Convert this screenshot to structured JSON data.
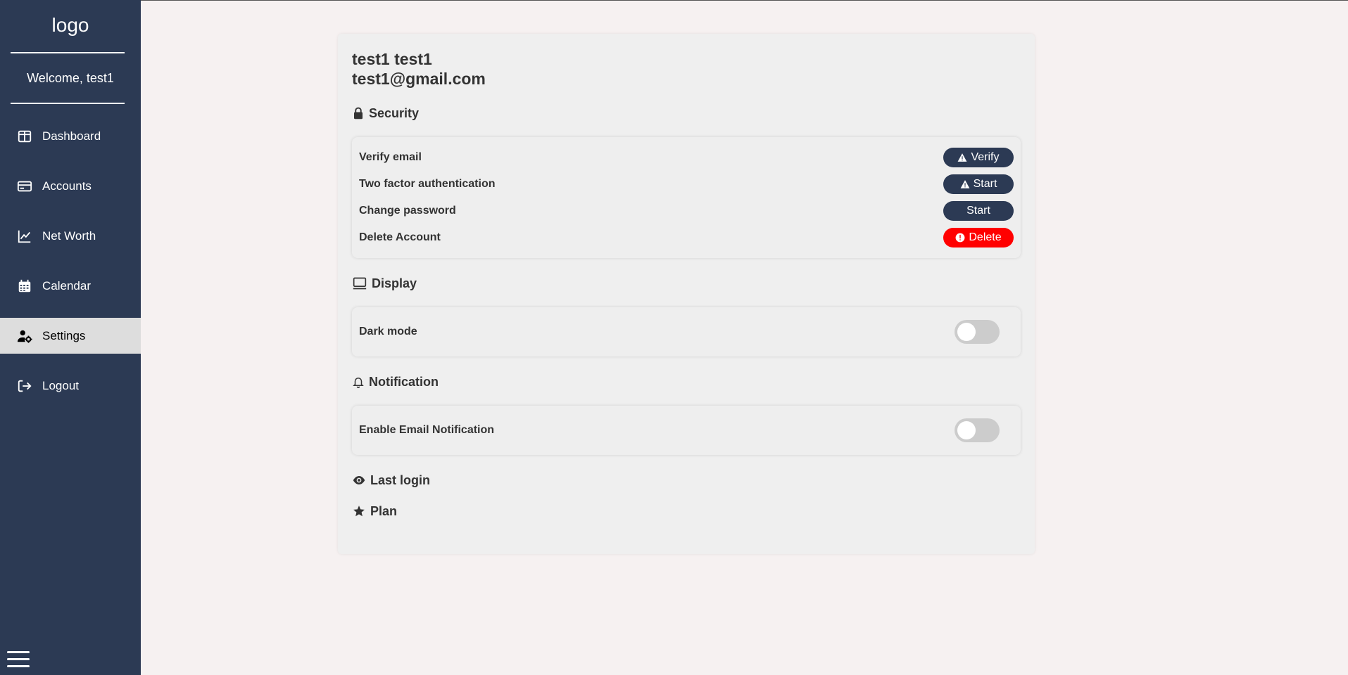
{
  "sidebar": {
    "logo": "logo",
    "welcome": "Welcome, test1",
    "items": [
      {
        "label": "Dashboard",
        "icon": "dashboard-icon"
      },
      {
        "label": "Accounts",
        "icon": "credit-card-icon"
      },
      {
        "label": "Net Worth",
        "icon": "chart-line-icon"
      },
      {
        "label": "Calendar",
        "icon": "calendar-icon"
      },
      {
        "label": "Settings",
        "icon": "user-gear-icon",
        "active": true
      },
      {
        "label": "Logout",
        "icon": "logout-icon"
      }
    ],
    "background": "#2c3a54",
    "active_background": "#dddddd"
  },
  "profile": {
    "name": "test1 test1",
    "email": "test1@gmail.com"
  },
  "security": {
    "title": "Security",
    "rows": [
      {
        "label": "Verify email",
        "button": "Verify",
        "icon": "warning-icon"
      },
      {
        "label": "Two factor authentication",
        "button": "Start",
        "icon": "warning-icon"
      },
      {
        "label": "Change password",
        "button": "Start"
      },
      {
        "label": "Delete Account",
        "button": "Delete",
        "icon": "exclamation-circle-icon",
        "danger": true
      }
    ]
  },
  "display": {
    "title": "Display",
    "dark_mode_label": "Dark mode",
    "dark_mode_on": false
  },
  "notification": {
    "title": "Notification",
    "email_label": "Enable Email Notification",
    "email_on": false
  },
  "last_login": {
    "title": "Last login"
  },
  "plan": {
    "title": "Plan"
  },
  "colors": {
    "primary": "#2c3a54",
    "danger": "#ff0000",
    "page_bg": "#f6f1f1"
  }
}
